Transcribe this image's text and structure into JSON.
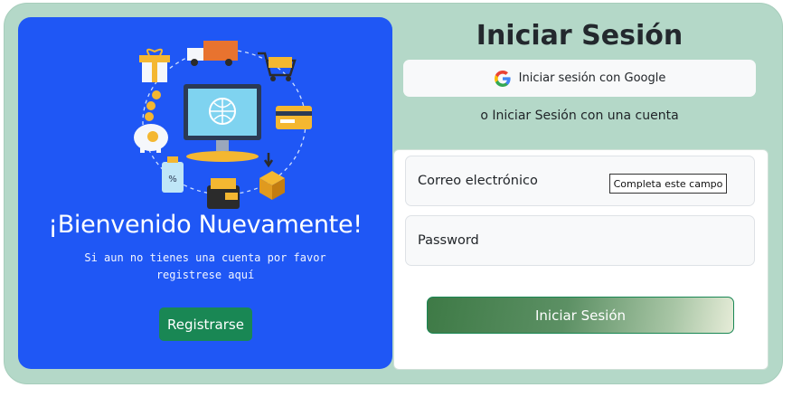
{
  "left_panel": {
    "welcome_title": "¡Bienvenido Nuevamente!",
    "subtext": "Si aun no tienes una cuenta por favor registrese aquí",
    "register_button": "Registrarse",
    "illustration_icons": [
      "gift-icon",
      "delivery-truck-icon",
      "shopping-cart-icon",
      "coins-icon",
      "piggy-bank-icon",
      "monitor-globe-icon",
      "credit-card-icon",
      "price-tag-icon",
      "wallet-icon",
      "package-icon"
    ]
  },
  "right_panel": {
    "title": "Iniciar Sesión",
    "google_button": "Iniciar sesión con Google",
    "or_text": "o Iniciar Sesión con una cuenta",
    "email_label": "Correo electrónico",
    "password_label": "Password",
    "validation_tooltip": "Completa este campo",
    "submit_button": "Iniciar Sesión"
  },
  "colors": {
    "background_card": "#b4d8c8",
    "left_panel": "#1f57f5",
    "register_button": "#198754"
  }
}
